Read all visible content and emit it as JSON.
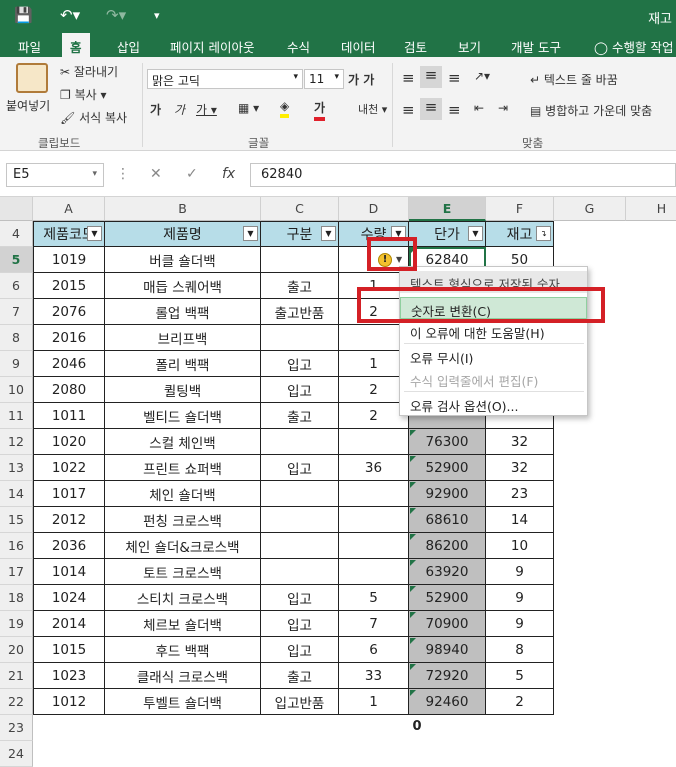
{
  "title": "재고",
  "tabs": [
    "파일",
    "홈",
    "삽입",
    "페이지 레이아웃",
    "수식",
    "데이터",
    "검토",
    "보기",
    "개발 도구"
  ],
  "tell_me": "수행할 작업",
  "ribbon": {
    "paste": "붙여넣기",
    "cut": "잘라내기",
    "copy": "복사",
    "format_painter": "서식 복사",
    "font_name": "맑은 고딕",
    "font_size": "11",
    "wrap_text": "텍스트 줄 바꿈",
    "merge_center": "병합하고 가운데 맞춤",
    "groups": {
      "clipboard": "클립보드",
      "font": "글꼴",
      "alignment": "맞춤"
    }
  },
  "formula_bar": {
    "name_box": "E5",
    "fx": "fx",
    "value": "62840"
  },
  "columns": [
    "A",
    "B",
    "C",
    "D",
    "E",
    "F",
    "G",
    "H"
  ],
  "headers": [
    "제품코드",
    "제품명",
    "구분",
    "수량",
    "단가",
    "재고"
  ],
  "rows": [
    {
      "n": "5",
      "a": "1019",
      "b": "버클 숄더백",
      "c": "",
      "d": "",
      "e": "62840",
      "f": "50"
    },
    {
      "n": "6",
      "a": "2015",
      "b": "매듭 스퀘어백",
      "c": "출고",
      "d": "1",
      "e": "",
      "f": ""
    },
    {
      "n": "7",
      "a": "2076",
      "b": "롤업 백팩",
      "c": "출고반품",
      "d": "2",
      "e": "",
      "f": ""
    },
    {
      "n": "8",
      "a": "2016",
      "b": "브리프백",
      "c": "",
      "d": "",
      "e": "",
      "f": ""
    },
    {
      "n": "9",
      "a": "2046",
      "b": "폴리 백팩",
      "c": "입고",
      "d": "1",
      "e": "",
      "f": ""
    },
    {
      "n": "10",
      "a": "2080",
      "b": "퀼팅백",
      "c": "입고",
      "d": "2",
      "e": "",
      "f": ""
    },
    {
      "n": "11",
      "a": "1011",
      "b": "벨티드 숄더백",
      "c": "출고",
      "d": "2",
      "e": "",
      "f": ""
    },
    {
      "n": "12",
      "a": "1020",
      "b": "스컬 체인백",
      "c": "",
      "d": "",
      "e": "76300",
      "f": "32"
    },
    {
      "n": "13",
      "a": "1022",
      "b": "프린트 쇼퍼백",
      "c": "입고",
      "d": "36",
      "e": "52900",
      "f": "32"
    },
    {
      "n": "14",
      "a": "1017",
      "b": "체인 숄더백",
      "c": "",
      "d": "",
      "e": "92900",
      "f": "23"
    },
    {
      "n": "15",
      "a": "2012",
      "b": "펀칭 크로스백",
      "c": "",
      "d": "",
      "e": "68610",
      "f": "14"
    },
    {
      "n": "16",
      "a": "2036",
      "b": "체인 숄더&크로스백",
      "c": "",
      "d": "",
      "e": "86200",
      "f": "10"
    },
    {
      "n": "17",
      "a": "1014",
      "b": "토트 크로스백",
      "c": "",
      "d": "",
      "e": "63920",
      "f": "9"
    },
    {
      "n": "18",
      "a": "1024",
      "b": "스티치 크로스백",
      "c": "입고",
      "d": "5",
      "e": "52900",
      "f": "9"
    },
    {
      "n": "19",
      "a": "2014",
      "b": "체르보 숄더백",
      "c": "입고",
      "d": "7",
      "e": "70900",
      "f": "9"
    },
    {
      "n": "20",
      "a": "1015",
      "b": "후드 백팩",
      "c": "입고",
      "d": "6",
      "e": "98940",
      "f": "8"
    },
    {
      "n": "21",
      "a": "1023",
      "b": "클래식 크로스백",
      "c": "출고",
      "d": "33",
      "e": "72920",
      "f": "5"
    },
    {
      "n": "22",
      "a": "1012",
      "b": "투벨트 숄더백",
      "c": "입고반품",
      "d": "1",
      "e": "92460",
      "f": "2"
    }
  ],
  "extra_rows": [
    "23",
    "24"
  ],
  "sum_value": "0",
  "context_menu": {
    "title": "텍스트 형식으로 저장된 숫자",
    "items": [
      "숫자로 변환(C)",
      "이 오류에 대한 도움말(H)",
      "오류 무시(I)",
      "수식 입력줄에서 편집(F)",
      "오류 검사 옵션(O)..."
    ]
  },
  "colors": {
    "accent": "#217346",
    "header_fill": "#b7dde8",
    "selection_fill": "#bfbfbf",
    "highlight_box": "#d42026"
  }
}
